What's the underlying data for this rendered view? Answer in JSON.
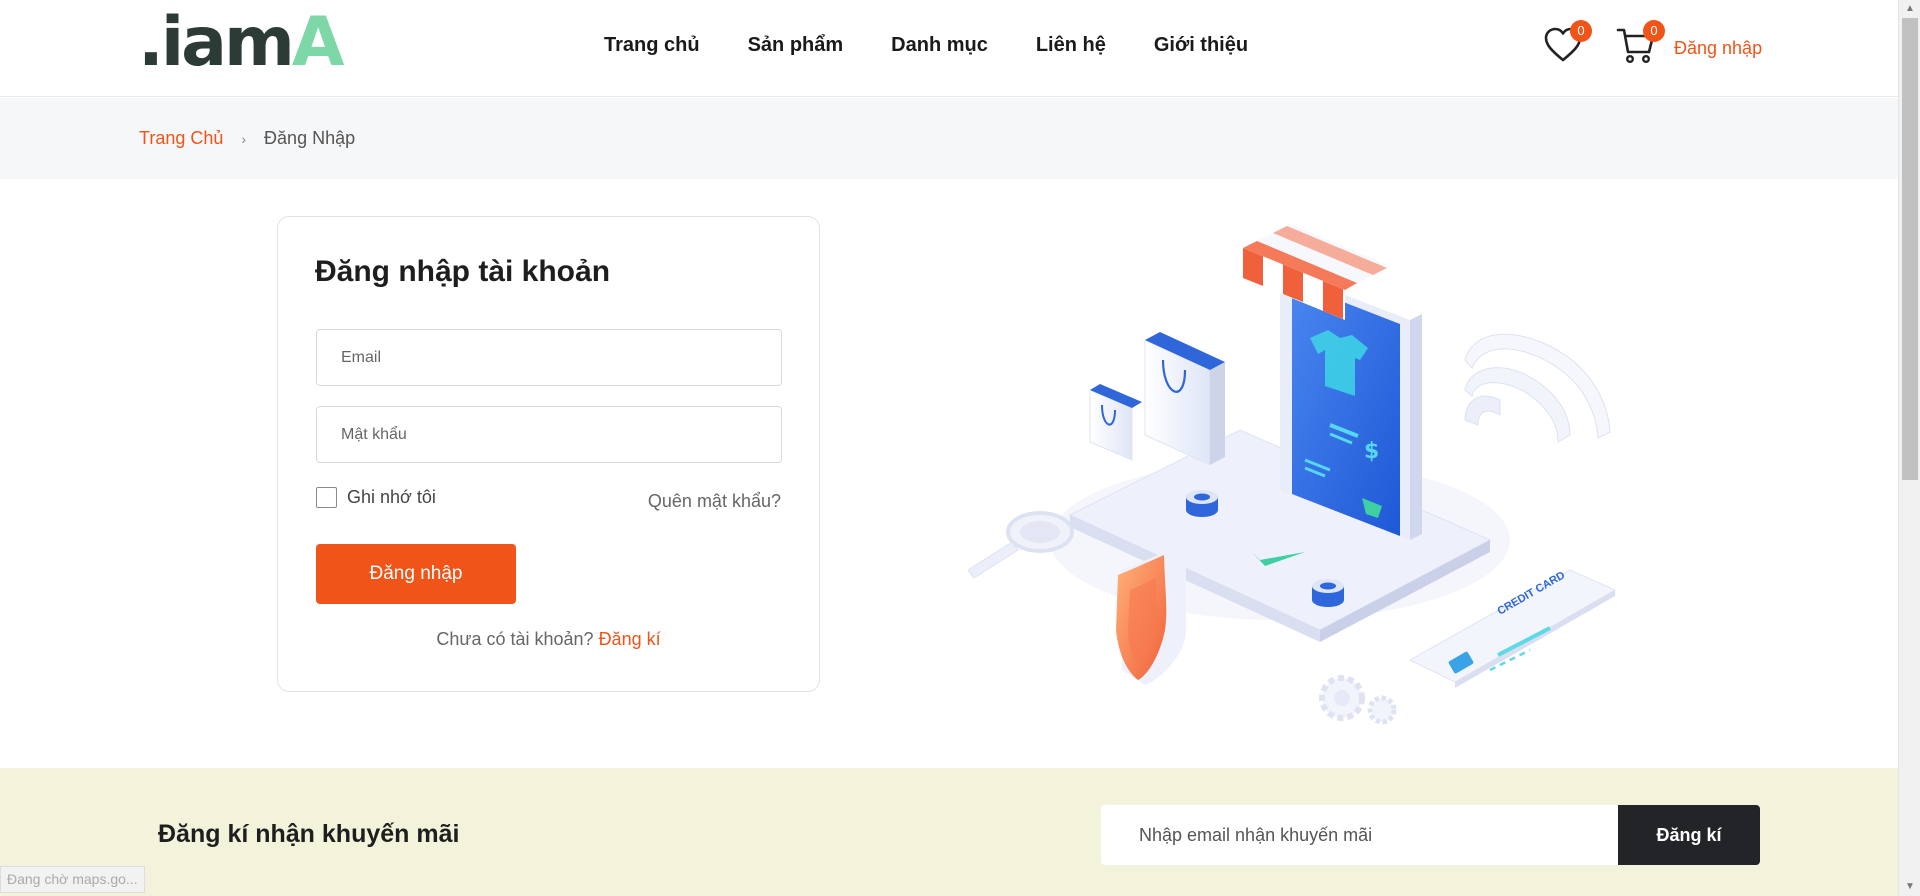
{
  "header": {
    "logo": {
      "dark": ".iam",
      "accent": "A"
    },
    "nav": [
      {
        "label": "Trang chủ"
      },
      {
        "label": "Sản phẩm"
      },
      {
        "label": "Danh mục"
      },
      {
        "label": "Liên hệ"
      },
      {
        "label": "Giới thiệu"
      }
    ],
    "wishlist": {
      "icon": "heart-icon",
      "count": "0"
    },
    "cart": {
      "icon": "cart-icon",
      "count": "0"
    },
    "login_link": "Đăng nhập"
  },
  "breadcrumb": {
    "home": "Trang Chủ",
    "separator": "›",
    "current": "Đăng Nhập"
  },
  "login_form": {
    "title": "Đăng nhập tài khoản",
    "email_placeholder": "Email",
    "password_placeholder": "Mật khẩu",
    "remember_label": "Ghi nhớ tôi",
    "forgot_label": "Quên mật khẩu?",
    "submit_label": "Đăng nhập",
    "no_account_text": "Chưa có tài khoản?",
    "register_link": "Đăng kí"
  },
  "illustration": {
    "card_text": "CREDIT CARD",
    "dollar_sign": "$"
  },
  "newsletter": {
    "title": "Đăng kí nhận khuyến mãi",
    "placeholder": "Nhập email nhận khuyến mãi",
    "button_label": "Đăng kí"
  },
  "status_bar": "Đang chờ maps.go...",
  "colors": {
    "accent": "#f05418",
    "logo_dark": "#2d3b36",
    "logo_green": "#7dd7a6",
    "newsletter_bg": "#f3f3dc",
    "dark_button": "#222428"
  }
}
